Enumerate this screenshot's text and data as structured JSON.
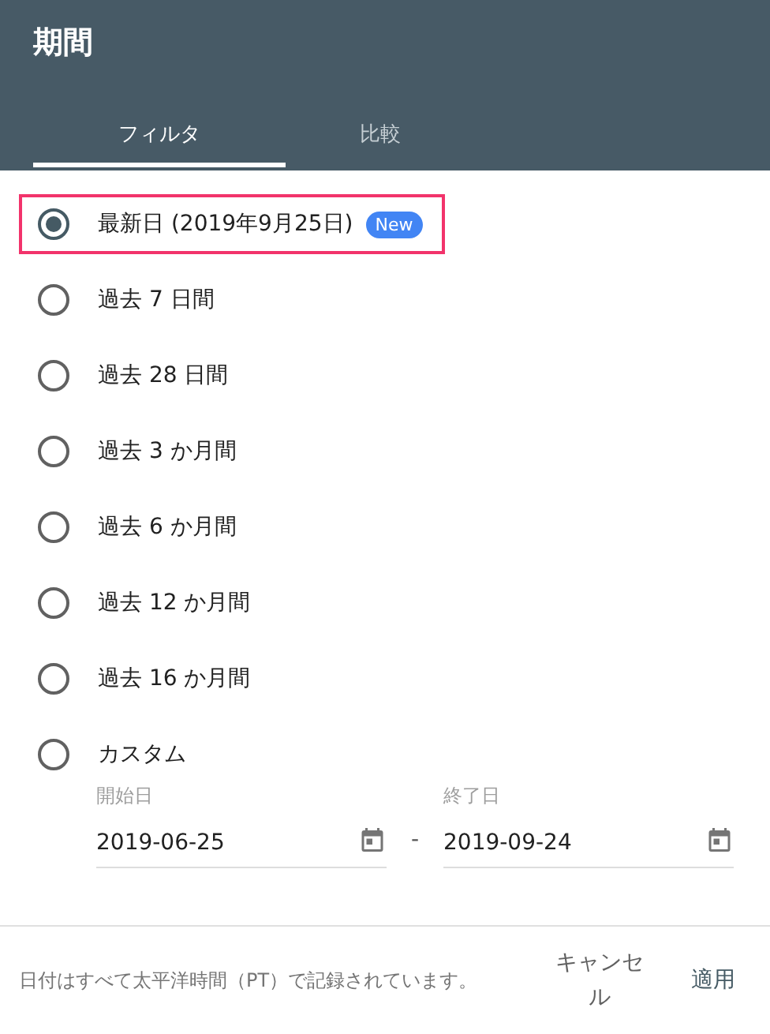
{
  "dialog": {
    "title": "期間"
  },
  "tabs": [
    {
      "label": "フィルタ",
      "selected": true
    },
    {
      "label": "比較",
      "selected": false
    }
  ],
  "options": [
    {
      "label": "最新日 (2019年9月25日)",
      "badge": "New",
      "selected": true,
      "highlighted": true
    },
    {
      "label": "過去 7 日間",
      "selected": false,
      "highlighted": false
    },
    {
      "label": "過去 28 日間",
      "selected": false,
      "highlighted": false
    },
    {
      "label": "過去 3 か月間",
      "selected": false,
      "highlighted": false
    },
    {
      "label": "過去 6 か月間",
      "selected": false,
      "highlighted": false
    },
    {
      "label": "過去 12 か月間",
      "selected": false,
      "highlighted": false
    },
    {
      "label": "過去 16 か月間",
      "selected": false,
      "highlighted": false
    },
    {
      "label": "カスタム",
      "selected": false,
      "highlighted": false
    }
  ],
  "custom_range": {
    "start": {
      "label": "開始日",
      "value": "2019-06-25"
    },
    "separator": "-",
    "end": {
      "label": "終了日",
      "value": "2019-09-24"
    }
  },
  "footer": {
    "note": "日付はすべて太平洋時間（PT）で記録されています。",
    "buttons": [
      {
        "label": "キャンセル",
        "kind": "secondary"
      },
      {
        "label": "適用",
        "kind": "primary"
      }
    ]
  }
}
